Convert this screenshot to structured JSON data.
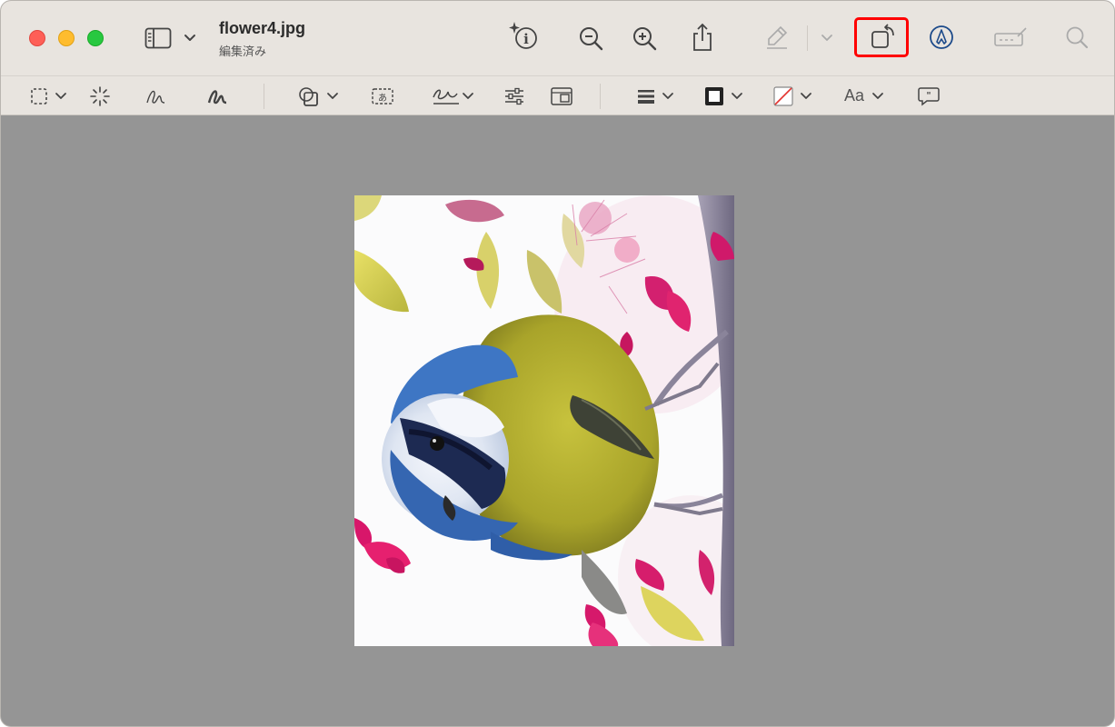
{
  "window": {
    "filename": "flower4.jpg",
    "status": "編集済み"
  },
  "toolbar": {
    "icons": [
      "sidebar-icon",
      "chevron-down-icon",
      "info-sparkle-icon",
      "zoom-out-icon",
      "zoom-in-icon",
      "share-icon",
      "highlighter-icon",
      "chevron-down-icon",
      "rotate-icon",
      "markup-icon",
      "signature-bar-icon",
      "search-icon"
    ],
    "highlighted": "rotate-button"
  },
  "markup_toolbar": {
    "text_style_label": "Aa"
  },
  "colors": {
    "highlight": "#ff0000",
    "background": "#959595",
    "toolbar": "#e8e4df"
  }
}
